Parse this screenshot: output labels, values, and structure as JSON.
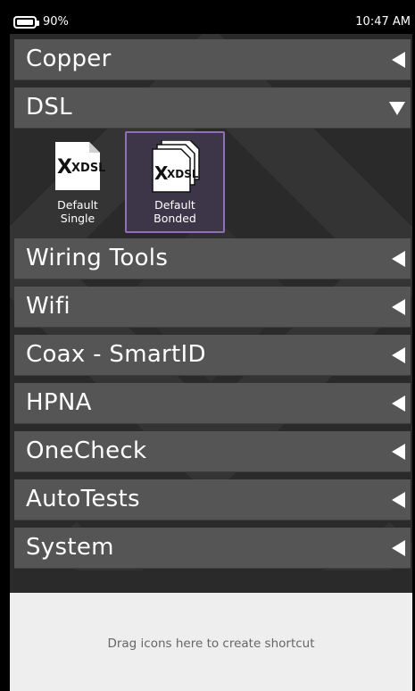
{
  "status_bar": {
    "battery": "90%",
    "time": "10:47 AM",
    "battery_icon": "battery-icon"
  },
  "categories": [
    {
      "label": "Copper",
      "state": "collapsed"
    },
    {
      "label": "DSL",
      "state": "expanded"
    },
    {
      "label": "Wiring Tools",
      "state": "collapsed"
    },
    {
      "label": "Wifi",
      "state": "collapsed"
    },
    {
      "label": "Coax - SmartID",
      "state": "collapsed"
    },
    {
      "label": "HPNA",
      "state": "collapsed"
    },
    {
      "label": "OneCheck",
      "state": "collapsed"
    },
    {
      "label": "AutoTests",
      "state": "collapsed"
    },
    {
      "label": "System",
      "state": "collapsed"
    }
  ],
  "dsl_tests": [
    {
      "icon_text": "XDSL",
      "label_line1": "Default",
      "label_line2": "Single",
      "selected": false,
      "icon": "xdsl-single-icon"
    },
    {
      "icon_text": "XDSL",
      "label_line1": "Default",
      "label_line2": "Bonded",
      "selected": true,
      "icon": "xdsl-bonded-icon"
    }
  ],
  "shortcut_area": {
    "text": "Drag icons here to create shortcut"
  },
  "colors": {
    "category_bar": "#585858",
    "background": "#2a2a2a",
    "selection": "#8f6fb8",
    "shortcut_area": "#eeeeee"
  }
}
